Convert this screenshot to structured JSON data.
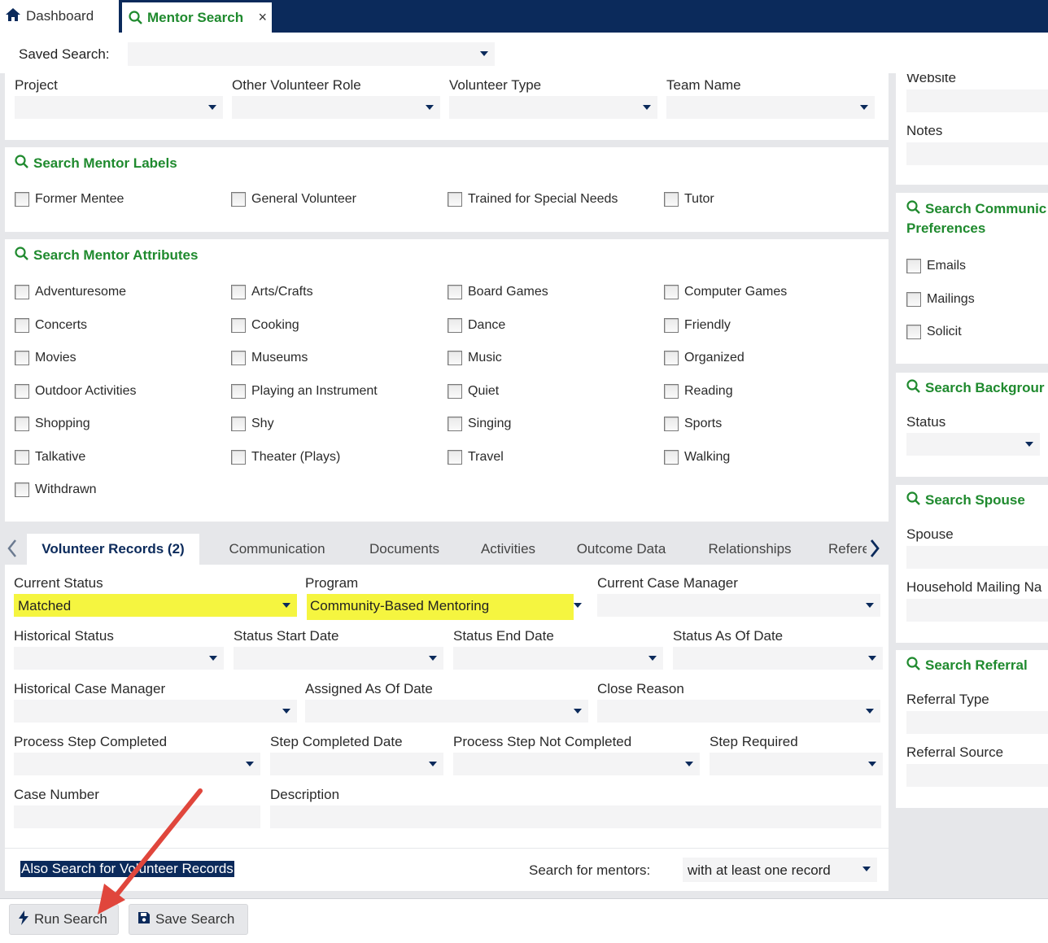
{
  "tabs": {
    "dashboard": "Dashboard",
    "mentor_search": "Mentor Search",
    "close": "×"
  },
  "saved_search": {
    "label": "Saved Search:",
    "value": ""
  },
  "fields_top": {
    "project": "Project",
    "other_role": "Other Volunteer Role",
    "volunteer_type": "Volunteer Type",
    "team_name": "Team Name"
  },
  "labels_section": {
    "title": "Search Mentor Labels",
    "items": [
      "Former Mentee",
      "General Volunteer",
      "Trained for Special Needs",
      "Tutor"
    ]
  },
  "attributes_section": {
    "title": "Search Mentor Attributes",
    "items": [
      "Adventuresome",
      "Arts/Crafts",
      "Board Games",
      "Computer Games",
      "Concerts",
      "Cooking",
      "Dance",
      "Friendly",
      "Movies",
      "Museums",
      "Music",
      "Organized",
      "Outdoor Activities",
      "Playing an Instrument",
      "Quiet",
      "Reading",
      "Shopping",
      "Shy",
      "Singing",
      "Sports",
      "Talkative",
      "Theater (Plays)",
      "Travel",
      "Walking",
      "Withdrawn"
    ]
  },
  "record_tabs": [
    "Volunteer Records (2)",
    "Communication",
    "Documents",
    "Activities",
    "Outcome Data",
    "Relationships",
    "Refere"
  ],
  "records": {
    "current_status": {
      "label": "Current Status",
      "value": "Matched"
    },
    "program": {
      "label": "Program",
      "value": "Community-Based Mentoring"
    },
    "current_case_manager": "Current Case Manager",
    "historical_status": "Historical Status",
    "status_start_date": "Status Start Date",
    "status_end_date": "Status End Date",
    "status_as_of_date": "Status As Of Date",
    "historical_case_manager": "Historical Case Manager",
    "assigned_as_of_date": "Assigned As Of Date",
    "close_reason": "Close Reason",
    "process_step_completed": "Process Step Completed",
    "step_completed_date": "Step Completed Date",
    "process_step_not_completed": "Process Step Not Completed",
    "step_required": "Step Required",
    "case_number": "Case Number",
    "description": "Description",
    "also_search": "Also Search for Volunteer Records",
    "search_for_mentors_label": "Search for mentors:",
    "search_for_mentors_value": "with at least one record"
  },
  "right": {
    "website": "Website",
    "notes": "Notes",
    "comm_title_1": "Search Communic",
    "comm_title_2": "Preferences",
    "comm_items": [
      "Emails",
      "Mailings",
      "Solicit"
    ],
    "background_title": "Search Backgrour",
    "status": "Status",
    "spouse_title": "Search Spouse",
    "spouse": "Spouse",
    "household": "Household Mailing Na",
    "referral_title": "Search Referral",
    "referral_type": "Referral Type",
    "referral_source": "Referral Source"
  },
  "buttons": {
    "run": "Run Search",
    "save": "Save Search"
  },
  "colors": {
    "navy": "#0b2a5b",
    "green": "#1f8a2e",
    "highlight": "#f5f540",
    "arrow": "#e0463c"
  }
}
